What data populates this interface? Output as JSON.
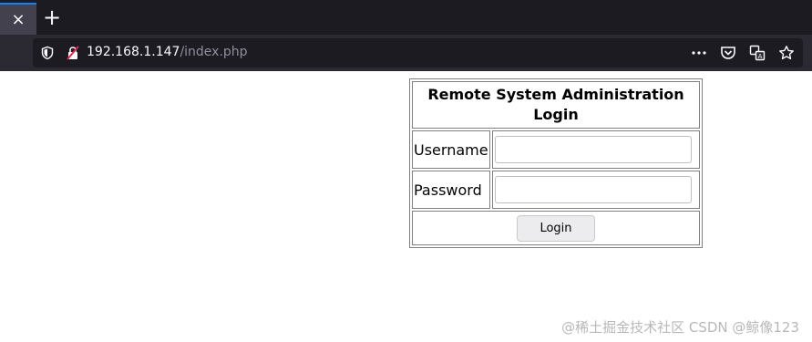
{
  "browser": {
    "tab_close_glyph": "×",
    "new_tab_glyph": "+",
    "url_host": "192.168.1.147",
    "url_path": "/index.php",
    "icons": [
      "shield-icon",
      "insecure-lock-icon",
      "more-icon",
      "pocket-icon",
      "translate-icon",
      "bookmark-star-icon"
    ]
  },
  "form": {
    "title": "Remote System Administration Login",
    "username_label": "Username",
    "password_label": "Password",
    "username_value": "",
    "password_value": "",
    "submit_label": "Login"
  },
  "watermark": {
    "text": "@稀土掘金技术社区 CSDN @鲸像123"
  }
}
